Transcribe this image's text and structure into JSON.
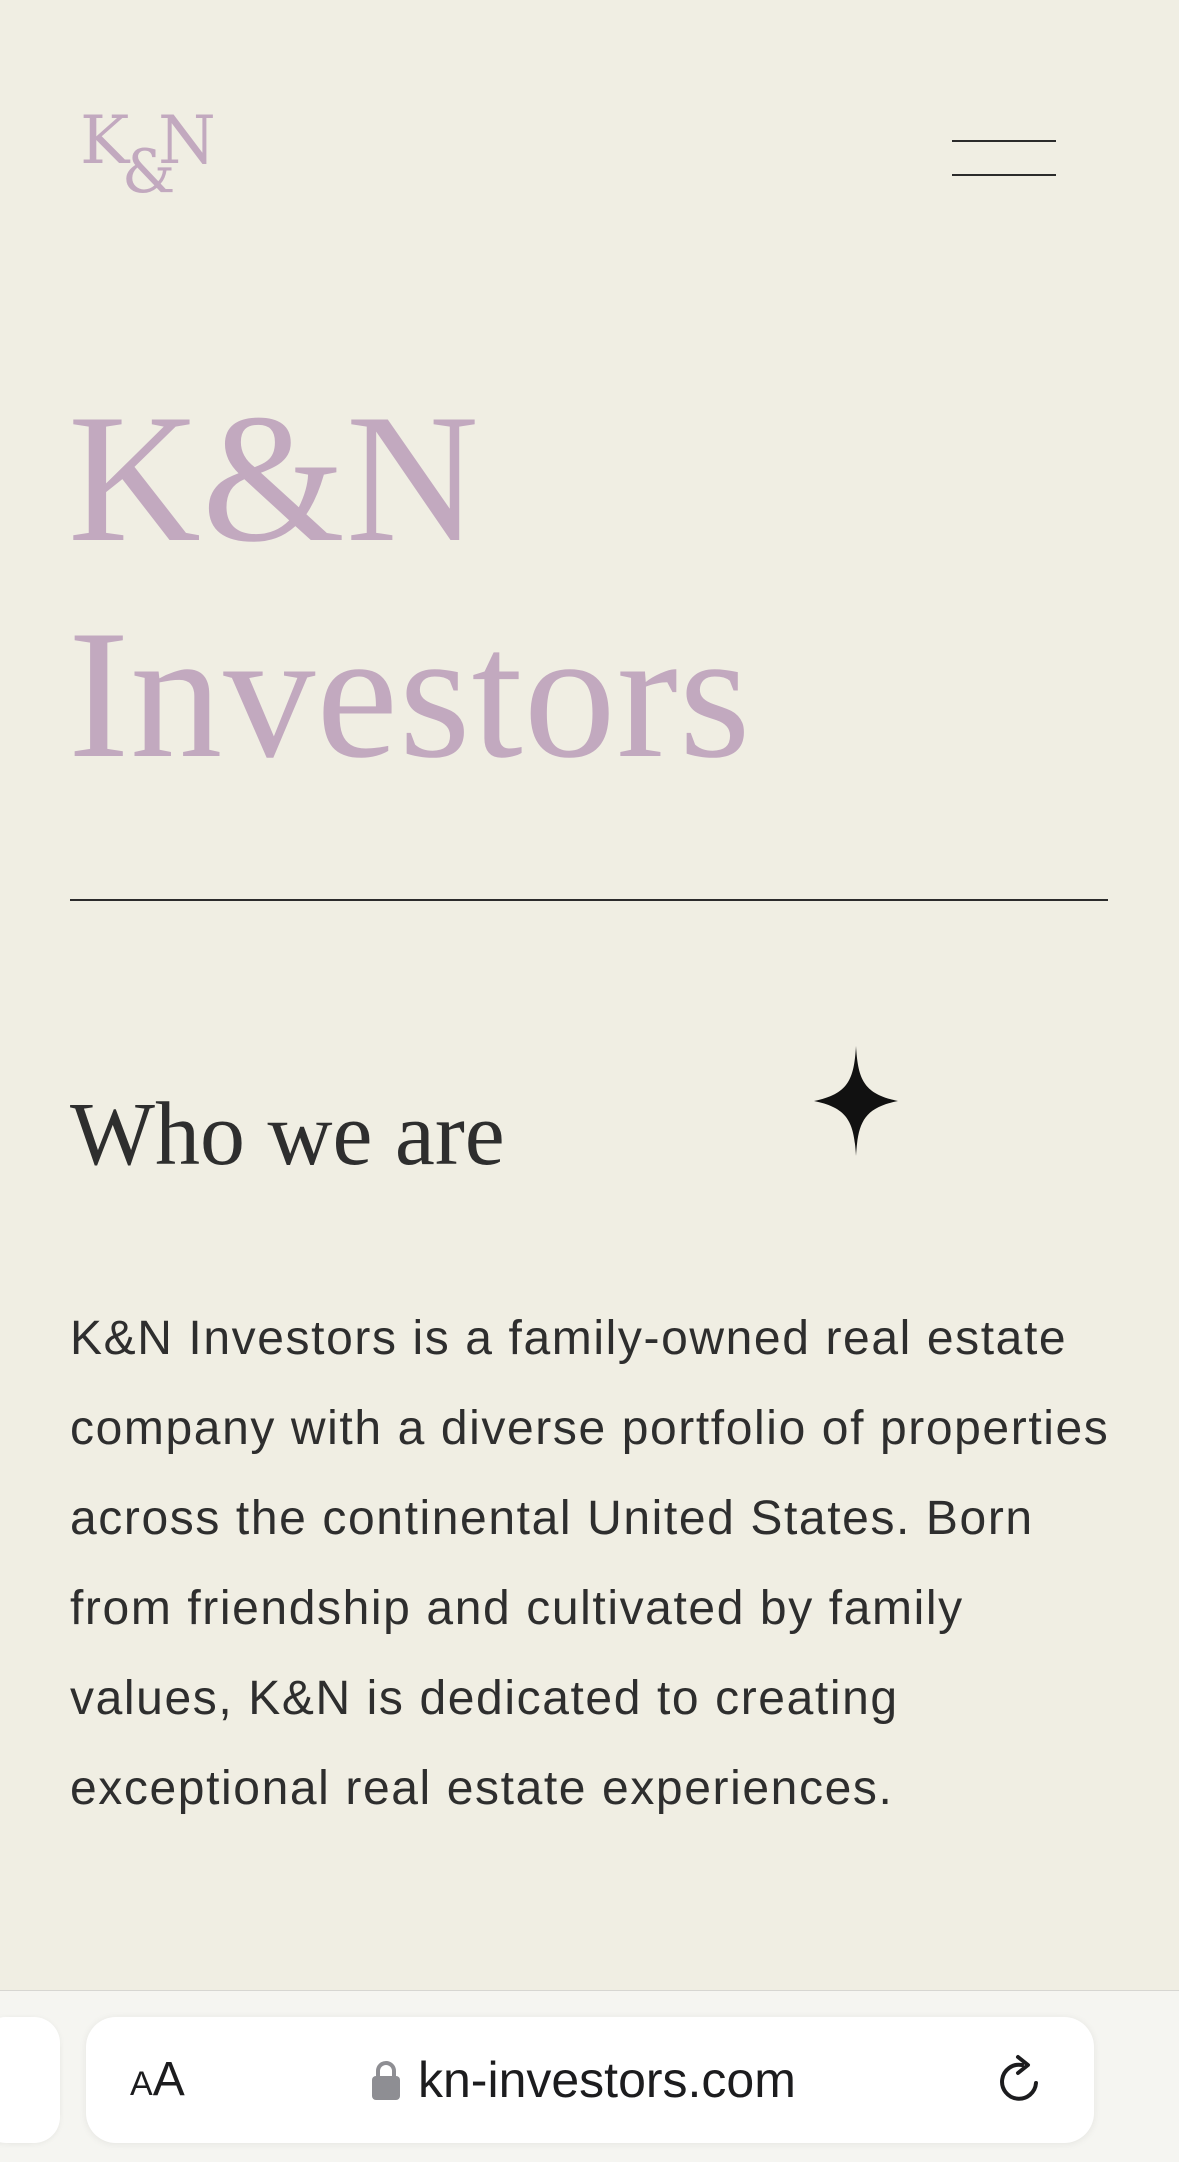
{
  "header": {
    "logo_k": "K",
    "logo_amp": "&",
    "logo_n": "N"
  },
  "hero": {
    "title_line1": "K&N",
    "title_line2": "Investors"
  },
  "about": {
    "heading": "Who we are",
    "body": "K&N Investors is a family-owned real estate company with a diverse portfolio of properties across the continental United States. Born from friendship and cultivated by family values, K&N is dedicated to creating exceptional real estate experiences."
  },
  "browser": {
    "aa_small": "A",
    "aa_large": "A",
    "url": "kn-investors.com"
  },
  "colors": {
    "background": "#f0eee3",
    "accent_mauve": "#c2a9bf",
    "text_dark": "#2e2e2e"
  },
  "icons": {
    "menu": "hamburger-menu-icon",
    "sparkle": "four-point-star-icon",
    "lock": "lock-icon",
    "reload": "reload-icon"
  }
}
